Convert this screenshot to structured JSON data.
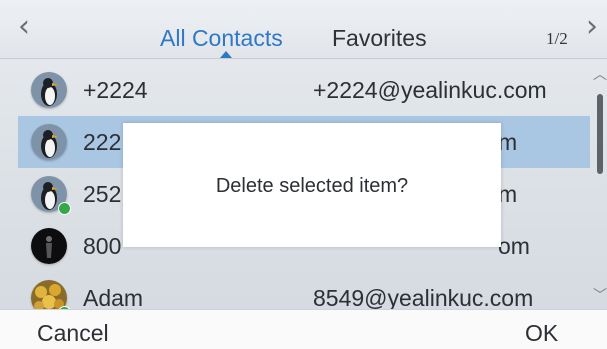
{
  "header": {
    "back_icon": "chevron-left-icon",
    "forward_icon": "chevron-right-icon",
    "tabs": [
      {
        "label": "All Contacts",
        "active": true
      },
      {
        "label": "Favorites",
        "active": false
      }
    ],
    "page_indicator": "1/2"
  },
  "contacts": [
    {
      "name": "+2224",
      "number": "+2224@yealinkuc.com",
      "avatar": "penguin-avatar",
      "selected": false,
      "status": "none"
    },
    {
      "name": "222",
      "number": "m",
      "avatar": "penguin-avatar",
      "selected": true,
      "status": "none"
    },
    {
      "name": "252",
      "number": "m",
      "avatar": "penguin-avatar",
      "selected": false,
      "status": "online"
    },
    {
      "name": "800",
      "number": "om",
      "avatar": "silhouette-avatar",
      "selected": false,
      "status": "none"
    },
    {
      "name": "Adam",
      "number": "8549@yealinkuc.com",
      "avatar": "flower-avatar",
      "selected": false,
      "status": "online"
    }
  ],
  "dialog": {
    "message": "Delete selected item?"
  },
  "softkeys": {
    "cancel": "Cancel",
    "ok": "OK"
  },
  "colors": {
    "accent": "#2f78c4",
    "selected_row": "#a9c6e2",
    "status_online": "#35a84a"
  }
}
